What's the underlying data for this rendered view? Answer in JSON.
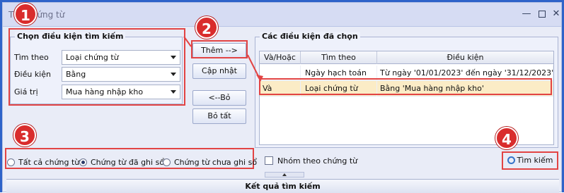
{
  "window": {
    "title": "Tìm chứng từ",
    "minimize_icon": "minimize-icon",
    "maximize_icon": "maximize-icon",
    "close_icon": "close-icon"
  },
  "criteria": {
    "legend": "Chọn điều kiện tìm kiếm",
    "search_by_label": "Tìm theo",
    "search_by_value": "Loại chứng từ",
    "condition_label": "Điều kiện",
    "condition_value": "Bằng",
    "value_label": "Giá trị",
    "value_value": "Mua hàng nhập kho"
  },
  "actions": {
    "add": "Thêm -->",
    "update": "Cập nhật",
    "remove": "<--Bỏ",
    "remove_all": "Bỏ tất"
  },
  "selected": {
    "legend": "Các điều kiện đã chọn",
    "columns": [
      "Và/Hoặc",
      "Tìm theo",
      "Điều kiện"
    ],
    "rows": [
      {
        "and_or": "",
        "field": "Ngày hạch toán",
        "condition": "Từ ngày '01/01/2023' đến ngày '31/12/2023'"
      },
      {
        "and_or": "Và",
        "field": "Loại chứng từ",
        "condition": "Bằng 'Mua hàng nhập kho'"
      }
    ]
  },
  "filter": {
    "all": "Tất cả chứng từ",
    "posted": "Chứng từ đã ghi sổ",
    "unposted": "Chứng từ chưa ghi sổ",
    "selected": "posted",
    "group_by_voucher": "Nhóm theo chứng từ"
  },
  "search_button": "Tìm kiếm",
  "results_header": "Kết quả tìm kiếm",
  "badges": [
    "1",
    "2",
    "3",
    "4"
  ],
  "colors": {
    "highlight": "#e24444",
    "selected_row": "#fbecc6",
    "window_border": "#2e63c9"
  }
}
